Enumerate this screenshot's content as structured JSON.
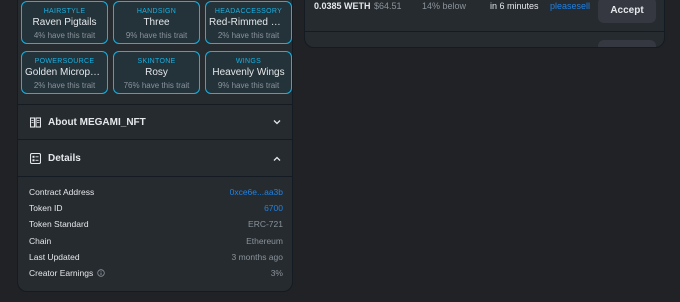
{
  "traits": [
    {
      "type": "HAIRSTYLE",
      "value": "Raven Pigtails",
      "rarity": "4% have this trait"
    },
    {
      "type": "HANDSIGN",
      "value": "Three",
      "rarity": "9% have this trait"
    },
    {
      "type": "HEADACCESSORY",
      "value": "Red-Rimmed Gl...",
      "rarity": "2% have this trait"
    },
    {
      "type": "POWERSOURCE",
      "value": "Golden Micropho...",
      "rarity": "2% have this trait"
    },
    {
      "type": "SKINTONE",
      "value": "Rosy",
      "rarity": "76% have this trait"
    },
    {
      "type": "WINGS",
      "value": "Heavenly Wings",
      "rarity": "9% have this trait"
    }
  ],
  "about": {
    "title": "About MEGAMI_NFT"
  },
  "details": {
    "title": "Details",
    "rows": [
      {
        "label": "Contract Address",
        "value": "0xce6e...aa3b"
      },
      {
        "label": "Token ID",
        "value": "6700"
      },
      {
        "label": "Token Standard",
        "value": "ERC-721"
      },
      {
        "label": "Chain",
        "value": "Ethereum"
      },
      {
        "label": "Last Updated",
        "value": "3 months ago"
      },
      {
        "label": "Creator Earnings",
        "value": "3%"
      }
    ]
  },
  "offer": {
    "price": "0.0385 WETH",
    "usd": "$64.51",
    "diff": "14% below",
    "expiration": "in 6 minutes",
    "from": "pleasesell",
    "accept_label": "Accept"
  },
  "colors": {
    "accent": "#2081e2",
    "trait_border": "#15b2e5",
    "panel": "#262b2f",
    "background": "#202225"
  }
}
